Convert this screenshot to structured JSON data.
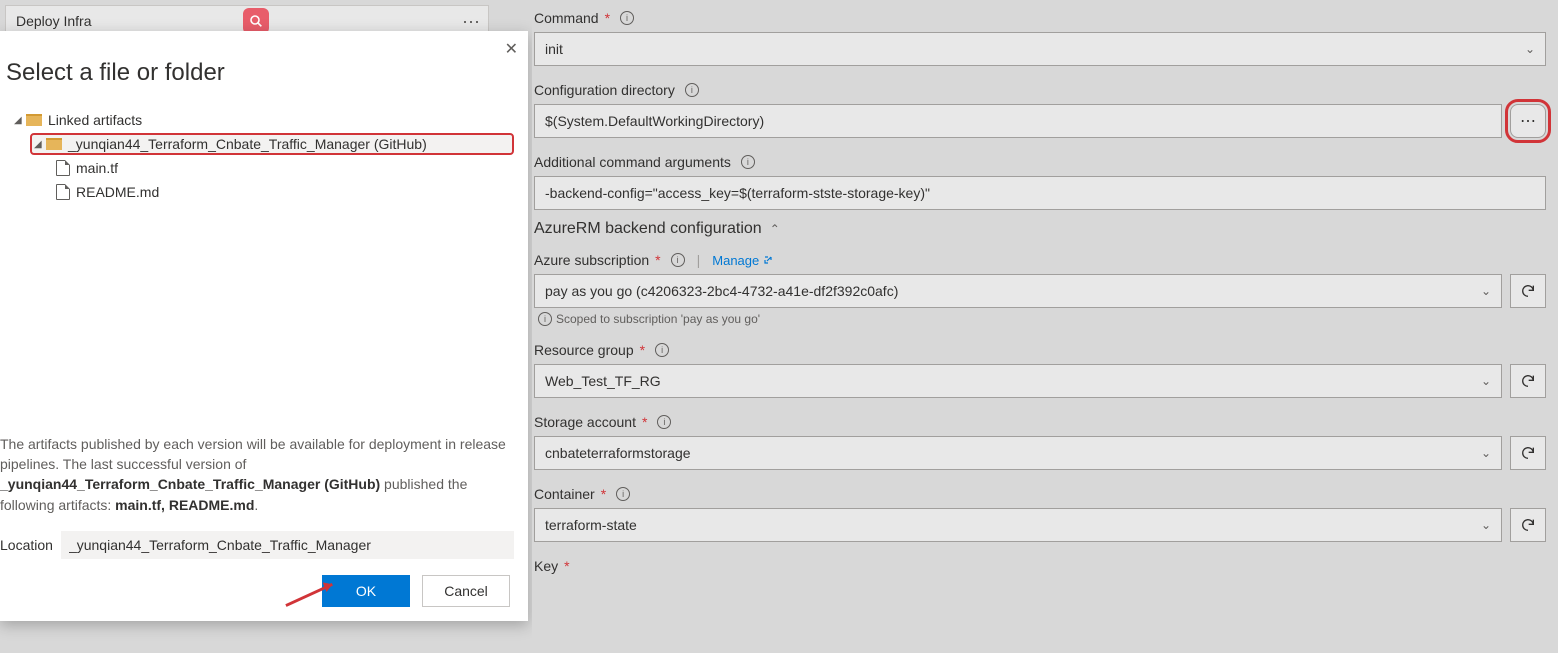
{
  "task": {
    "title": "Deploy Infra"
  },
  "dialog": {
    "title": "Select a file or folder",
    "tree": {
      "root_label": "Linked artifacts",
      "repo_label": "_yunqian44_Terraform_Cnbate_Traffic_Manager (GitHub)",
      "files": [
        "main.tf",
        "README.md"
      ]
    },
    "footer_text_1": "The artifacts published by each version will be available for deployment in release pipelines. The last successful version of ",
    "footer_text_bold_1": "_yunqian44_Terraform_Cnbate_Traffic_Manager (GitHub)",
    "footer_text_2": " published the following artifacts: ",
    "footer_text_bold_2": "main.tf, README.md",
    "footer_text_3": ".",
    "location_label": "Location",
    "location_value": "_yunqian44_Terraform_Cnbate_Traffic_Manager",
    "ok": "OK",
    "cancel": "Cancel"
  },
  "form": {
    "command": {
      "label": "Command",
      "value": "init"
    },
    "config_dir": {
      "label": "Configuration directory",
      "value": "$(System.DefaultWorkingDirectory)"
    },
    "add_args": {
      "label": "Additional command arguments",
      "value": "-backend-config=\"access_key=$(terraform-stste-storage-key)\""
    },
    "section": "AzureRM backend configuration",
    "subscription": {
      "label": "Azure subscription",
      "manage": "Manage",
      "value": "pay as you go (c4206323-2bc4-4732-a41e-df2f392c0afc)"
    },
    "scoped_note": "Scoped to subscription 'pay as you go'",
    "resource_group": {
      "label": "Resource group",
      "value": "Web_Test_TF_RG"
    },
    "storage_account": {
      "label": "Storage account",
      "value": "cnbateterraformstorage"
    },
    "container": {
      "label": "Container",
      "value": "terraform-state"
    },
    "key": {
      "label": "Key"
    }
  }
}
